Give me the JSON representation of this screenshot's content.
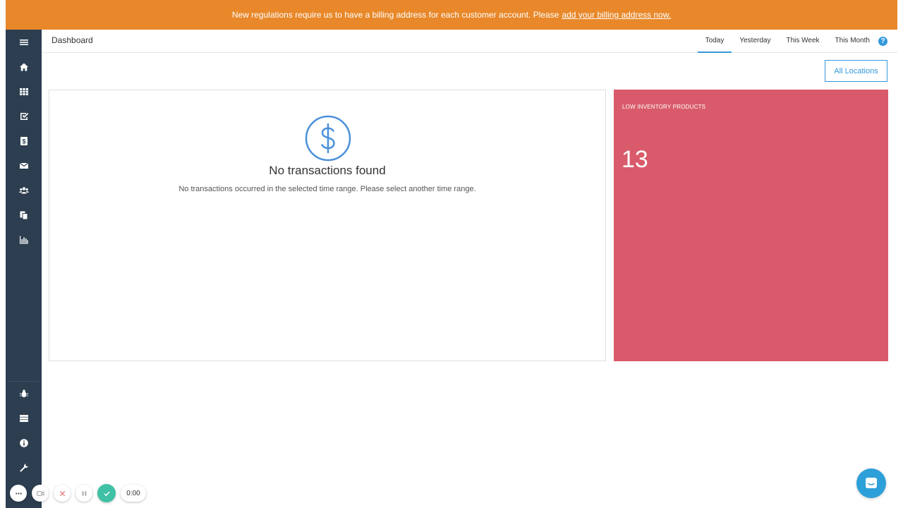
{
  "banner": {
    "text": "New regulations require us to have a billing address for each customer account. Please",
    "link": "add your billing address now."
  },
  "sidebar": {
    "top_icons": [
      "menu-icon",
      "home-icon",
      "grid-icon",
      "checklist-icon",
      "dollar-box-icon",
      "envelope-icon",
      "users-icon",
      "documents-icon",
      "bar-chart-icon"
    ],
    "bottom_icons": [
      "bug-icon",
      "server-icon",
      "info-icon",
      "wrench-icon"
    ]
  },
  "header": {
    "title": "Dashboard",
    "tabs": [
      {
        "label": "Today",
        "active": true
      },
      {
        "label": "Yesterday",
        "active": false
      },
      {
        "label": "This Week",
        "active": false
      },
      {
        "label": "This Month",
        "active": false
      }
    ],
    "help": "?"
  },
  "locations_button": "All Locations",
  "transactions": {
    "title": "No transactions found",
    "message": "No transactions occurred in the selected time range. Please select another time range.",
    "icon": "dollar-circle-icon"
  },
  "low_inventory": {
    "label": "LOW INVENTORY PRODUCTS",
    "value": "13",
    "color": "#d95b6b"
  },
  "recorder": {
    "time": "0:00"
  },
  "colors": {
    "banner": "#e8882a",
    "sidebar": "#2c3e50",
    "accent": "#3498db"
  }
}
